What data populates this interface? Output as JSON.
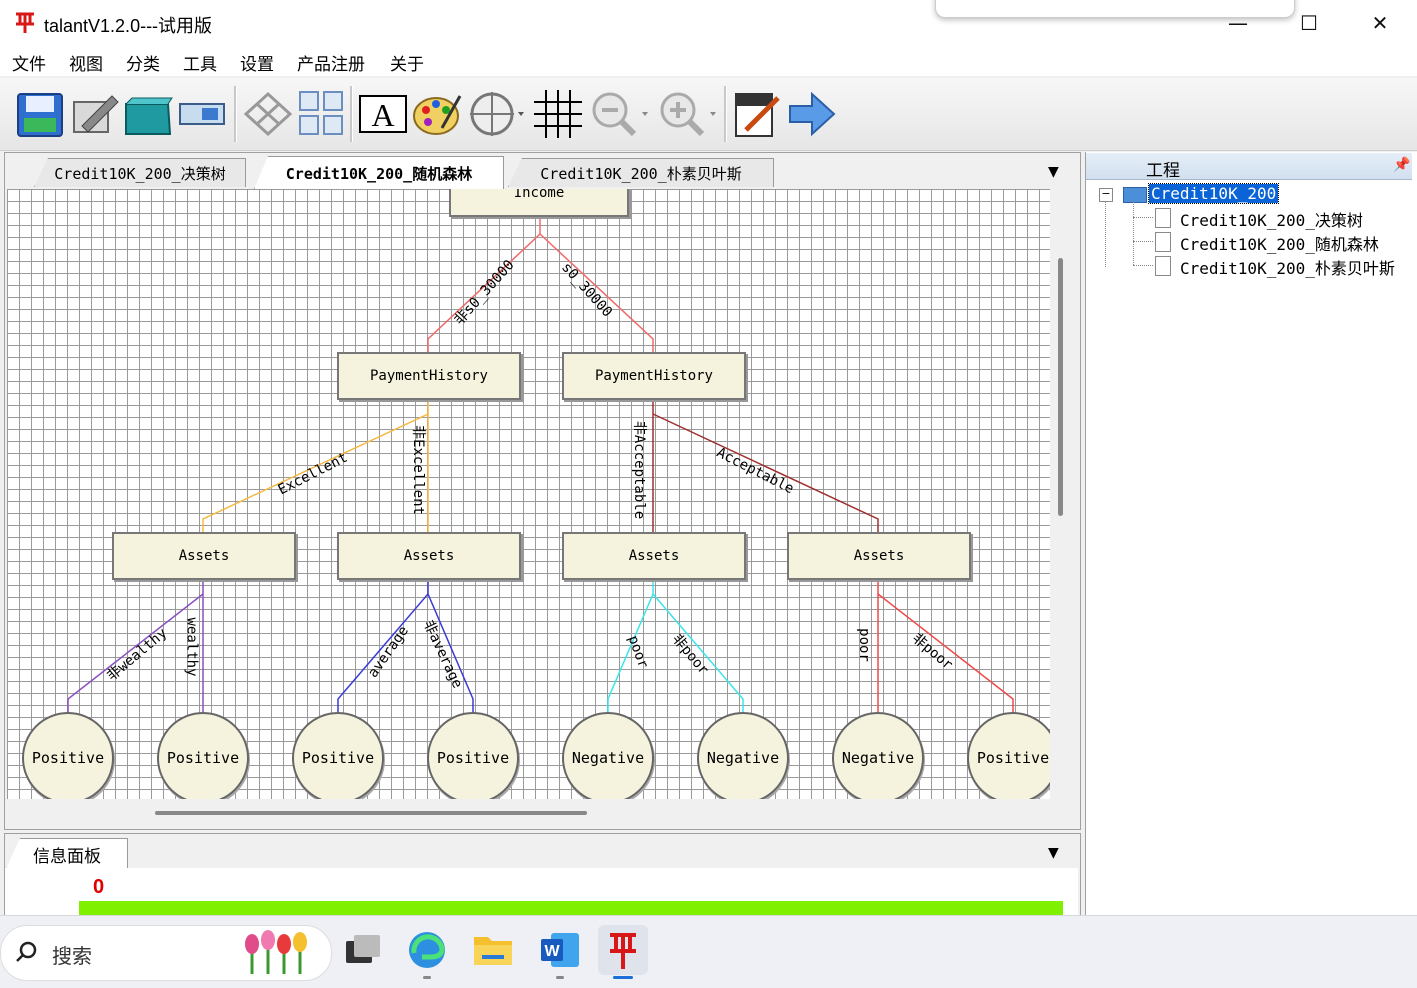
{
  "window": {
    "title": "talantV1.2.0---试用版"
  },
  "menu": [
    "文件",
    "视图",
    "分类",
    "工具",
    "设置",
    "产品注册",
    "关于"
  ],
  "toolbar": {
    "buttons": [
      "save-icon",
      "edit-icon",
      "open-icon",
      "print-icon",
      "network-icon",
      "grid-layout-icon",
      "text-icon",
      "palette-icon",
      "target-icon",
      "grid-icon",
      "zoom-out-icon",
      "zoom-in-icon",
      "bmp-export-icon",
      "next-arrow-icon"
    ]
  },
  "tabs": [
    {
      "label": "Credit10K_200_决策树",
      "active": false
    },
    {
      "label": "Credit10K_200_随机森林",
      "active": true
    },
    {
      "label": "Credit10K_200_朴素贝叶斯",
      "active": false
    }
  ],
  "tree": {
    "root": "Income",
    "level1": [
      "PaymentHistory",
      "PaymentHistory"
    ],
    "level1_edges": [
      "非s0_30000",
      "s0_30000"
    ],
    "level2": [
      "Assets",
      "Assets",
      "Assets",
      "Assets"
    ],
    "level2_edges": [
      "Excellent",
      "非Excellent",
      "非Acceptable",
      "Acceptable"
    ],
    "leaves": [
      "Positive",
      "Positive",
      "Positive",
      "Positive",
      "Negative",
      "Negative",
      "Negative",
      "Positive"
    ],
    "leaf_edges": [
      "非wealthy",
      "wealthy",
      "average",
      "非average",
      "poor",
      "非poor",
      "poor",
      "非poor"
    ],
    "edge_colors": {
      "root": "#f06a6a",
      "left_payment": "#f5b942",
      "right_payment": "#a03030",
      "assets1": "#8a4fc0",
      "assets2": "#3a3ad8",
      "assets3": "#38e6ec",
      "assets4": "#f04848"
    }
  },
  "project_panel": {
    "title": "工程",
    "root": "Credit10K_200",
    "children": [
      "Credit10K_200_决策树",
      "Credit10K_200_随机森林",
      "Credit10K_200_朴素贝叶斯"
    ]
  },
  "info_panel": {
    "tab": "信息面板",
    "value": "0"
  },
  "taskbar": {
    "search": "搜索"
  }
}
